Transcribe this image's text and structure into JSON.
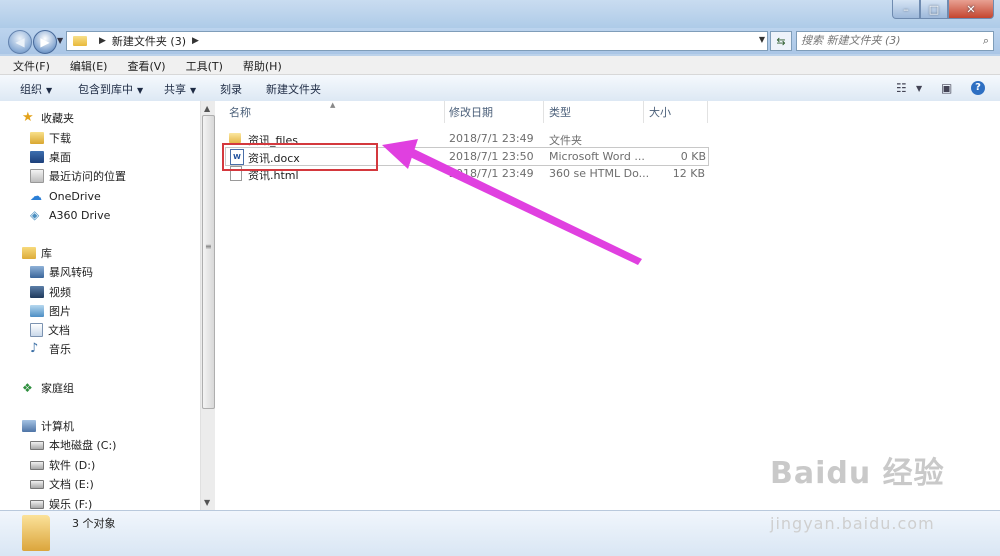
{
  "window": {
    "min_glyph": "–",
    "max_glyph": "□",
    "close_glyph": "✕"
  },
  "address_bar": {
    "breadcrumb": "新建文件夹 (3)",
    "search_placeholder": "搜索 新建文件夹 (3)"
  },
  "menu": [
    "文件(F)",
    "编辑(E)",
    "查看(V)",
    "工具(T)",
    "帮助(H)"
  ],
  "toolbar": {
    "organize": "组织",
    "include_in_library": "包含到库中",
    "share": "共享",
    "burn": "刻录",
    "new_folder": "新建文件夹"
  },
  "sidebar": {
    "favorites": {
      "label": "收藏夹",
      "items": [
        "下载",
        "桌面",
        "最近访问的位置",
        "OneDrive",
        "A360 Drive"
      ]
    },
    "libraries": {
      "label": "库",
      "items": [
        "暴风转码",
        "视频",
        "图片",
        "文档",
        "音乐"
      ]
    },
    "homegroup": "家庭组",
    "computer": {
      "label": "计算机",
      "items": [
        "本地磁盘 (C:)",
        "软件 (D:)",
        "文档 (E:)",
        "娱乐 (F:)"
      ]
    }
  },
  "columns": [
    "名称",
    "修改日期",
    "类型",
    "大小"
  ],
  "files": [
    {
      "name": "资讯_files",
      "date": "2018/7/1 23:49",
      "type": "文件夹",
      "size": "",
      "icon": "folder-icon"
    },
    {
      "name": "资讯.docx",
      "date": "2018/7/1 23:50",
      "type": "Microsoft Word ...",
      "size": "0 KB",
      "icon": "word-doc-icon",
      "selected": true
    },
    {
      "name": "资讯.html",
      "date": "2018/7/1 23:49",
      "type": "360 se HTML Do...",
      "size": "12 KB",
      "icon": "html-file-icon"
    }
  ],
  "status": {
    "count": "3 个对象"
  },
  "annotation": {
    "highlight_color": "#d4383d",
    "arrow_color": "#e040e0"
  },
  "watermark": {
    "main": "Baidu 经验",
    "sub": "jingyan.baidu.com"
  }
}
